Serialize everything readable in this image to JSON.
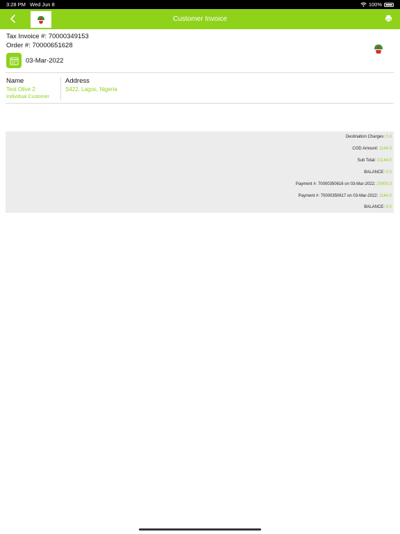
{
  "status_bar": {
    "time": "3:28 PM",
    "date": "Wed Jun 8",
    "battery": "100%"
  },
  "header": {
    "title": "Customer Invoice",
    "back_icon": "chevron-left-icon",
    "print_icon": "printer-icon"
  },
  "invoice": {
    "tax_invoice": "Tax Invoice #: 70000349153",
    "order": "Order #: 70000651628",
    "date": "03-Mar-2022"
  },
  "customer": {
    "name_label": "Name",
    "name": "Test Olive 2",
    "type": "Individual Customer",
    "address_label": "Address",
    "address": "S422, Lagos, Nigeria"
  },
  "summary": {
    "rows": [
      {
        "label": "Destination Charges: ",
        "value": "0.0"
      },
      {
        "label": "COD Amount: ",
        "value": "1144.0"
      },
      {
        "label": "Sub Total: ",
        "value": "21144.0"
      },
      {
        "label": "BALANCE: ",
        "value": "0.0"
      },
      {
        "label": "Payment #: 70000350616 on 03-Mar-2022: ",
        "value": "20000.0"
      },
      {
        "label": "Payment #: 70000350617 on 03-Mar-2022: ",
        "value": "1144.0"
      },
      {
        "label": "BALANCE: ",
        "value": "0.0"
      }
    ]
  },
  "colors": {
    "accent": "#8ed21a",
    "summary_bg": "#ececec"
  }
}
